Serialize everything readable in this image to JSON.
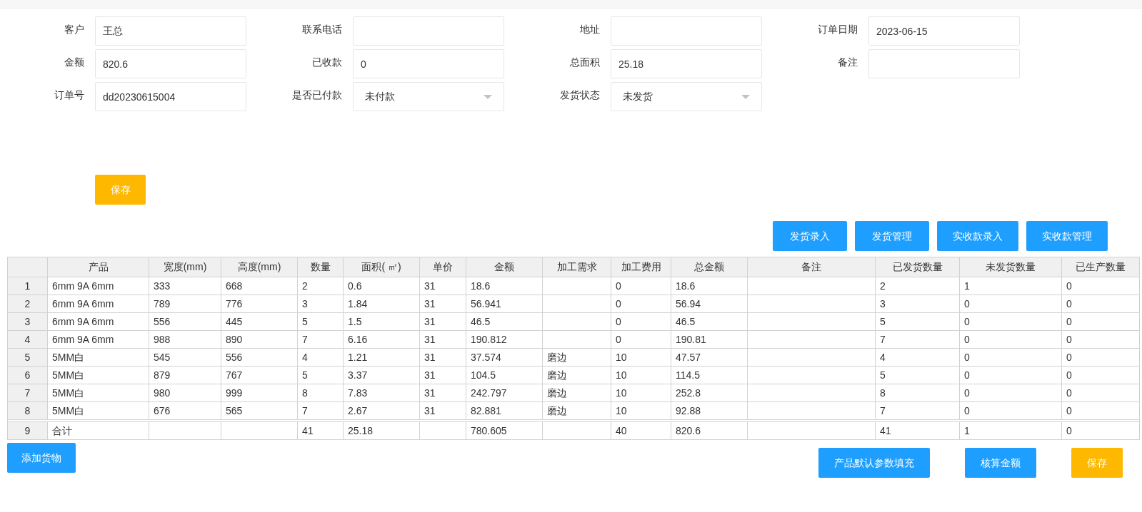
{
  "form": {
    "fields": [
      {
        "label": "客户",
        "kind": "input",
        "value": "王总"
      },
      {
        "label": "联系电话",
        "kind": "input"
      },
      {
        "label": "地址",
        "kind": "input"
      },
      {
        "label": "订单日期",
        "kind": "input",
        "value": "2023-06-15"
      },
      {
        "label": "金额",
        "kind": "input",
        "value": "820.6"
      },
      {
        "label": "已收款",
        "kind": "input",
        "value": "0"
      },
      {
        "label": "总面积",
        "kind": "input",
        "value": "25.18"
      },
      {
        "label": "备注",
        "kind": "input"
      },
      {
        "label": "订单号",
        "kind": "input",
        "value": "dd20230615004"
      },
      {
        "label": "是否已付款",
        "kind": "select",
        "value": "未付款"
      },
      {
        "label": "发货状态",
        "kind": "select",
        "value": "未发货"
      }
    ],
    "save_button": "保存"
  },
  "toolbar": [
    "发货录入",
    "发货管理",
    "实收款录入",
    "实收款管理"
  ],
  "table": {
    "columns": [
      null,
      "产品",
      "宽度(mm)",
      "高度(mm)",
      "数量",
      "面积( ㎡)",
      "单价",
      "金额",
      "加工需求",
      "加工费用",
      "总金额",
      "备注",
      "已发货数量",
      "未发货数量",
      "已生产数量"
    ],
    "rows": [
      [
        "1",
        "6mm 9A 6mm",
        "333",
        "668",
        "2",
        "0.6",
        "31",
        "18.6",
        null,
        "0",
        "18.6",
        null,
        "2",
        "1",
        "0"
      ],
      [
        "2",
        "6mm 9A 6mm",
        "789",
        "776",
        "3",
        "1.84",
        "31",
        "56.941",
        null,
        "0",
        "56.94",
        null,
        "3",
        "0",
        "0"
      ],
      [
        "3",
        "6mm 9A 6mm",
        "556",
        "445",
        "5",
        "1.5",
        "31",
        "46.5",
        null,
        "0",
        "46.5",
        null,
        "5",
        "0",
        "0"
      ],
      [
        "4",
        "6mm 9A 6mm",
        "988",
        "890",
        "7",
        "6.16",
        "31",
        "190.812",
        null,
        "0",
        "190.81",
        null,
        "7",
        "0",
        "0"
      ],
      [
        "5",
        "5MM白",
        "545",
        "556",
        "4",
        "1.21",
        "31",
        "37.574",
        "磨边",
        "10",
        "47.57",
        null,
        "4",
        "0",
        "0"
      ],
      [
        "6",
        "5MM白",
        "879",
        "767",
        "5",
        "3.37",
        "31",
        "104.5",
        "磨边",
        "10",
        "114.5",
        null,
        "5",
        "0",
        "0"
      ],
      [
        "7",
        "5MM白",
        "980",
        "999",
        "8",
        "7.83",
        "31",
        "242.797",
        "磨边",
        "10",
        "252.8",
        null,
        "8",
        "0",
        "0"
      ],
      [
        "8",
        "5MM白",
        "676",
        "565",
        "7",
        "2.67",
        "31",
        "82.881",
        "磨边",
        "10",
        "92.88",
        null,
        "7",
        "0",
        "0"
      ]
    ],
    "total_row": {
      "0": "9",
      "1": "合计",
      "4": "41",
      "5": "25.18",
      "7": "780.605",
      "9": "40",
      "10": "820.6",
      "12": "41",
      "13": "1",
      "14": "0"
    }
  },
  "bottom_buttons": [
    {
      "label": "添加货物",
      "kind": "primary"
    },
    {
      "label": "产品默认参数填充",
      "kind": "primary"
    },
    {
      "label": "核算金额",
      "kind": "primary"
    },
    {
      "label": "保存",
      "kind": "warning"
    }
  ]
}
